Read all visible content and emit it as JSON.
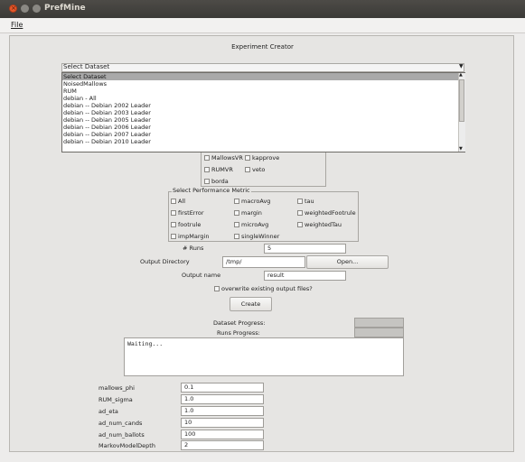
{
  "window": {
    "title": "PrefMine"
  },
  "menu": {
    "file": "File"
  },
  "header": {
    "title": "Experiment Creator"
  },
  "dataset_select": {
    "value": "Select Dataset",
    "options": [
      "Select Dataset",
      "NoisedMallows",
      "RUM",
      "debian - All",
      "debian --  Debian 2002 Leader",
      "debian --  Debian 2003 Leader",
      "debian --  Debian 2005 Leader",
      "debian --  Debian 2006 Leader",
      "debian --  Debian 2007 Leader",
      "debian --  Debian 2010 Leader"
    ]
  },
  "algorithms": {
    "items": [
      "MallowsVR",
      "kapprove",
      "RUMVR",
      "veto",
      "borda"
    ]
  },
  "metrics": {
    "title": "Select Performance Metric",
    "items": [
      "All",
      "macroAvg",
      "tau",
      "firstError",
      "margin",
      "weightedFootrule",
      "footrule",
      "microAvg",
      "weightedTau",
      "impMargin",
      "singleWinner"
    ]
  },
  "runs": {
    "label": "# Runs",
    "value": "5"
  },
  "output_dir": {
    "label": "Output Directory",
    "value": "/tmp/",
    "button": "Open..."
  },
  "output_name": {
    "label": "Output name",
    "value": "result"
  },
  "overwrite": {
    "label": "overwrite existing output files?"
  },
  "create_button": "Create",
  "progress": {
    "dataset_label": "Dataset Progress:",
    "runs_label": "Runs Progress:"
  },
  "log": {
    "text": "Waiting..."
  },
  "params": [
    {
      "label": "mallows_phi",
      "value": "0.1"
    },
    {
      "label": "RUM_sigma",
      "value": "1.0"
    },
    {
      "label": "ad_eta",
      "value": "1.0"
    },
    {
      "label": "ad_num_cands",
      "value": "10"
    },
    {
      "label": "ad_num_ballots",
      "value": "100"
    },
    {
      "label": "MarkovModelDepth",
      "value": "2"
    }
  ]
}
